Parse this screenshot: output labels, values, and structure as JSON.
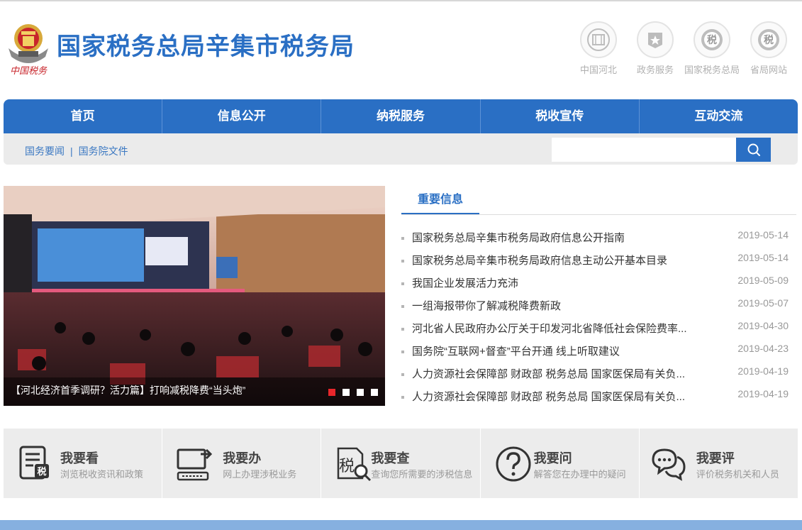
{
  "header": {
    "logo_text": "中国税务",
    "site_title": "国家税务总局辛集市税务局",
    "quick_links": [
      {
        "label": "中国河北",
        "icon": "hebei-emblem-icon"
      },
      {
        "label": "政务服务",
        "icon": "star-icon"
      },
      {
        "label": "国家税务总局",
        "icon": "tax-badge-icon"
      },
      {
        "label": "省局网站",
        "icon": "tax-badge-icon"
      }
    ]
  },
  "nav": {
    "items": [
      "首页",
      "信息公开",
      "纳税服务",
      "税收宣传",
      "互动交流"
    ]
  },
  "subbar": {
    "links": [
      "国务要闻",
      "国务院文件"
    ],
    "separator": "|",
    "search_placeholder": ""
  },
  "banner": {
    "caption": "【河北经济首季调研？活力篇】打响减税降费“当头炮”",
    "slides": 4,
    "active_slide": 1,
    "colors": {
      "accent": "#e8262b"
    }
  },
  "news": {
    "tab_label": "重要信息",
    "items": [
      {
        "title": "国家税务总局辛集市税务局政府信息公开指南",
        "date": "2019-05-14"
      },
      {
        "title": "国家税务总局辛集市税务局政府信息主动公开基本目录",
        "date": "2019-05-14"
      },
      {
        "title": "我国企业发展活力充沛",
        "date": "2019-05-09"
      },
      {
        "title": "一组海报带你了解减税降费新政",
        "date": "2019-05-07"
      },
      {
        "title": "河北省人民政府办公厅关于印发河北省降低社会保险费率...",
        "date": "2019-04-30"
      },
      {
        "title": "国务院“互联网+督查”平台开通 线上听取建议",
        "date": "2019-04-23"
      },
      {
        "title": "人力资源社会保障部 财政部 税务总局 国家医保局有关负...",
        "date": "2019-04-19"
      },
      {
        "title": "人力资源社会保障部 财政部 税务总局 国家医保局有关负...",
        "date": "2019-04-19"
      }
    ]
  },
  "services": [
    {
      "title": "我要看",
      "desc": "浏览税收资讯和政策",
      "icon": "document-tax-icon"
    },
    {
      "title": "我要办",
      "desc": "网上办理涉税业务",
      "icon": "computer-arrow-icon"
    },
    {
      "title": "我要查",
      "desc": "查询您所需要的涉税信息",
      "icon": "tax-search-icon"
    },
    {
      "title": "我要问",
      "desc": "解答您在办理中的疑问",
      "icon": "question-icon"
    },
    {
      "title": "我要评",
      "desc": "评价税务机关和人员",
      "icon": "chat-bubbles-icon"
    }
  ],
  "colors": {
    "brand_blue": "#2a6fc4",
    "subbar_gray": "#ebebeb",
    "service_gray": "#ececec"
  }
}
